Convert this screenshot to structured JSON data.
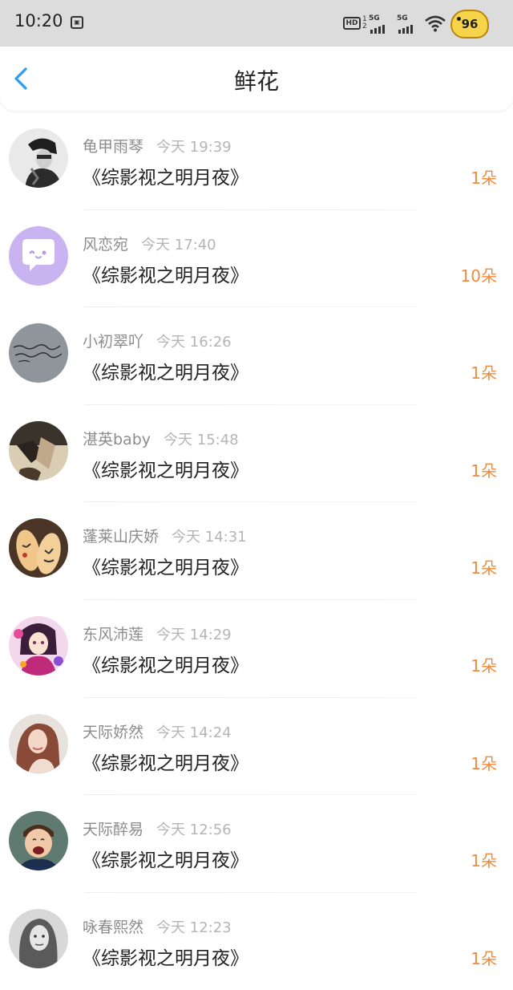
{
  "status_bar": {
    "time": "10:20",
    "battery": "96",
    "network_1": "5G",
    "network_2": "5G",
    "hd_label": "HD",
    "hd_sub_1": "1",
    "hd_sub_2": "2"
  },
  "header": {
    "title": "鲜花",
    "back_icon": "chevron-left-icon"
  },
  "colors": {
    "accent_orange": "#f08a3c",
    "back_blue": "#2a9df4",
    "name_gray": "#8c8c8c",
    "time_gray": "#b5b5b5"
  },
  "items": [
    {
      "name": "龟甲雨琴",
      "time": "今天 19:39",
      "book": "《综影视之明月夜》",
      "count": "1朵",
      "avatar": "bw-portrait-avatar"
    },
    {
      "name": "风恋宛",
      "time": "今天 17:40",
      "book": "《综影视之明月夜》",
      "count": "10朵",
      "avatar": "purple-chat-bubble-avatar"
    },
    {
      "name": "小初翠吖",
      "time": "今天 16:26",
      "book": "《综影视之明月夜》",
      "count": "1朵",
      "avatar": "handwriting-avatar"
    },
    {
      "name": "湛英baby",
      "time": "今天 15:48",
      "book": "《综影视之明月夜》",
      "count": "1朵",
      "avatar": "shoes-avatar"
    },
    {
      "name": "蓬莱山庆娇",
      "time": "今天 14:31",
      "book": "《综影视之明月夜》",
      "count": "1朵",
      "avatar": "finger-faces-avatar"
    },
    {
      "name": "东风沛莲",
      "time": "今天 14:29",
      "book": "《综影视之明月夜》",
      "count": "1朵",
      "avatar": "anime-girl-avatar"
    },
    {
      "name": "天际娇然",
      "time": "今天 14:24",
      "book": "《综影视之明月夜》",
      "count": "1朵",
      "avatar": "woman-portrait-avatar"
    },
    {
      "name": "天际醉易",
      "time": "今天 12:56",
      "book": "《综影视之明月夜》",
      "count": "1朵",
      "avatar": "laughing-child-avatar"
    },
    {
      "name": "咏春熙然",
      "time": "今天 12:23",
      "book": "《综影视之明月夜》",
      "count": "1朵",
      "avatar": "bw-woman-avatar"
    }
  ]
}
